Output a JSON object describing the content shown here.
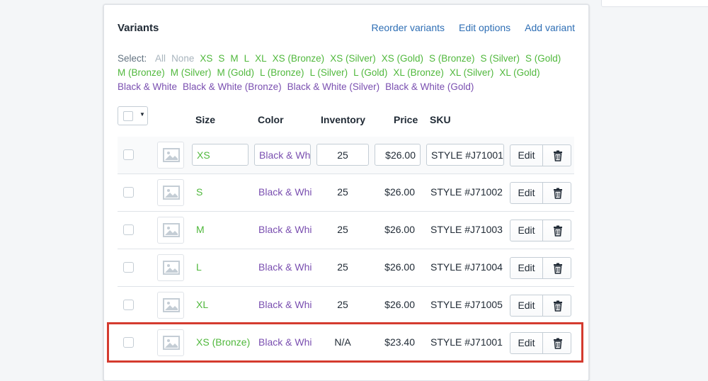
{
  "variants": {
    "title": "Variants",
    "actions": [
      "Reorder variants",
      "Edit options",
      "Add variant"
    ],
    "select_label": "Select:",
    "select_options": [
      {
        "label": "All",
        "kind": "gray"
      },
      {
        "label": "None",
        "kind": "gray"
      },
      {
        "label": "XS",
        "kind": "green"
      },
      {
        "label": "S",
        "kind": "green"
      },
      {
        "label": "M",
        "kind": "green"
      },
      {
        "label": "L",
        "kind": "green"
      },
      {
        "label": "XL",
        "kind": "green"
      },
      {
        "label": "XS (Bronze)",
        "kind": "green"
      },
      {
        "label": "XS (Silver)",
        "kind": "green"
      },
      {
        "label": "XS (Gold)",
        "kind": "green"
      },
      {
        "label": "S (Bronze)",
        "kind": "green"
      },
      {
        "label": "S (Silver)",
        "kind": "green"
      },
      {
        "label": "S (Gold)",
        "kind": "green"
      },
      {
        "label": "M (Bronze)",
        "kind": "green"
      },
      {
        "label": "M (Silver)",
        "kind": "green"
      },
      {
        "label": "M (Gold)",
        "kind": "green"
      },
      {
        "label": "L (Bronze)",
        "kind": "green"
      },
      {
        "label": "L (Silver)",
        "kind": "green"
      },
      {
        "label": "L (Gold)",
        "kind": "green"
      },
      {
        "label": "XL (Bronze)",
        "kind": "green"
      },
      {
        "label": "XL (Silver)",
        "kind": "green"
      },
      {
        "label": "XL (Gold)",
        "kind": "green"
      },
      {
        "label": "Black & White",
        "kind": "purple"
      },
      {
        "label": "Black & White (Bronze)",
        "kind": "purple"
      },
      {
        "label": "Black & White (Silver)",
        "kind": "purple"
      },
      {
        "label": "Black & White (Gold)",
        "kind": "purple"
      }
    ],
    "columns": {
      "size": "Size",
      "color": "Color",
      "inventory": "Inventory",
      "price": "Price",
      "sku": "SKU"
    },
    "edit_label": "Edit",
    "rows": [
      {
        "size": "XS",
        "color": "Black & White",
        "inventory": "25",
        "price": "$26.00",
        "sku": "STYLE #J71001",
        "editing": true
      },
      {
        "size": "S",
        "color": "Black & White",
        "inventory": "25",
        "price": "$26.00",
        "sku": "STYLE #J71002",
        "editing": false
      },
      {
        "size": "M",
        "color": "Black & White",
        "inventory": "25",
        "price": "$26.00",
        "sku": "STYLE #J71003",
        "editing": false
      },
      {
        "size": "L",
        "color": "Black & White",
        "inventory": "25",
        "price": "$26.00",
        "sku": "STYLE #J71004",
        "editing": false
      },
      {
        "size": "XL",
        "color": "Black & White",
        "inventory": "25",
        "price": "$26.00",
        "sku": "STYLE #J71005",
        "editing": false
      },
      {
        "size": "XS (Bronze)",
        "color": "Black & White",
        "inventory": "N/A",
        "price": "$23.40",
        "sku": "STYLE #J71001",
        "editing": false,
        "highlighted": true
      }
    ]
  },
  "colors": {
    "link": "#2f6fb5",
    "size_option": "#50b83c",
    "color_option": "#7a4fb0",
    "highlight": "#d43b2f"
  }
}
